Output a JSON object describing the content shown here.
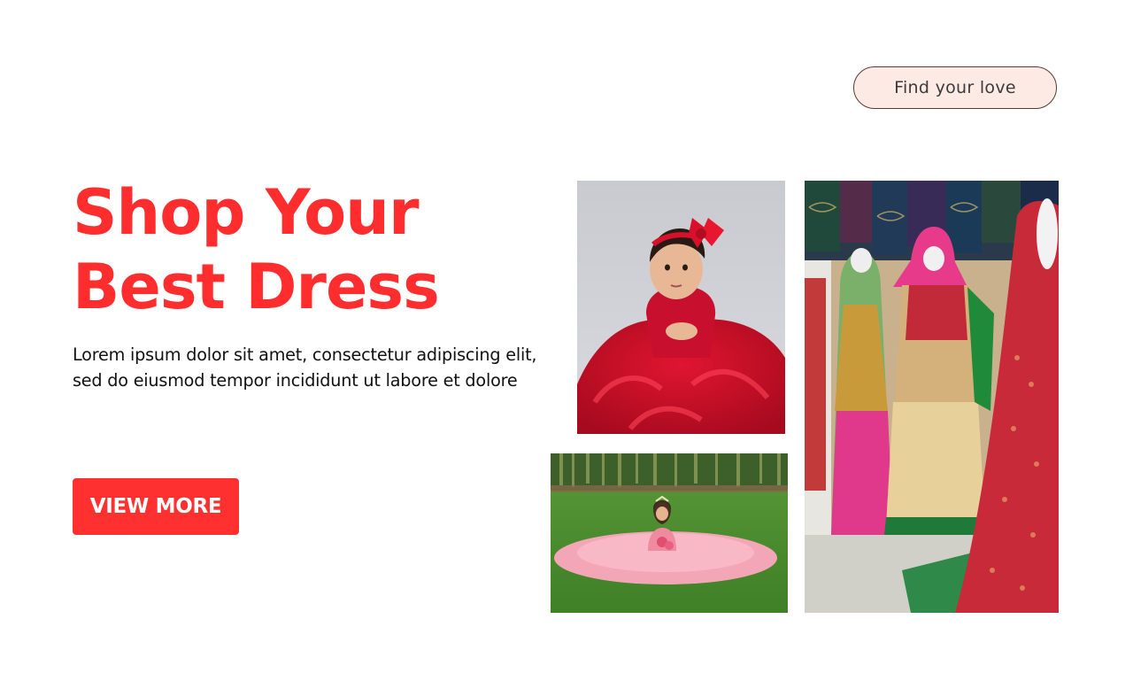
{
  "header": {
    "cta_label": "Find your love"
  },
  "hero": {
    "title_line1": "Shop Your",
    "title_line2": "Best Dress",
    "description": "Lorem ipsum dolor sit amet, consectetur adipiscing elit, sed do eiusmod tempor incididunt ut labore et dolore",
    "button_label": "VIEW MORE"
  },
  "colors": {
    "accent": "#ff2d2d",
    "button_bg": "#ff3030",
    "pill_bg": "#fdeae4",
    "pill_border": "#5a3b34"
  }
}
